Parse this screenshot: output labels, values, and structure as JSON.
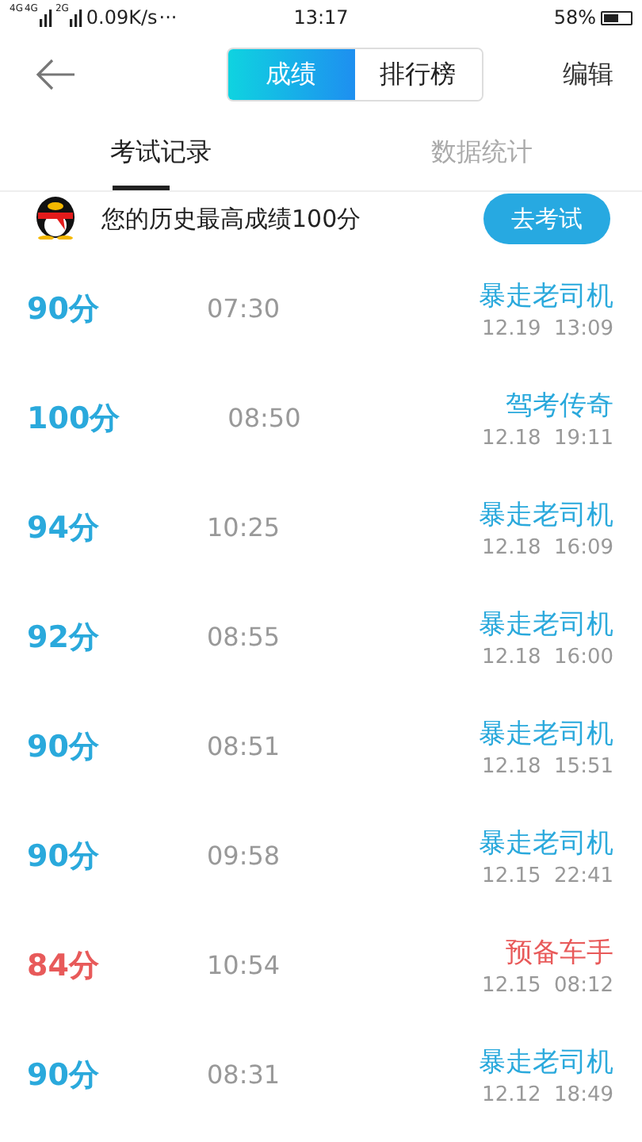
{
  "status_bar": {
    "network_labels": [
      "4G",
      "4G",
      "2G"
    ],
    "speed": "0.09K/s",
    "more": "···",
    "time": "13:17",
    "battery_text": "58%"
  },
  "header": {
    "segments": [
      {
        "label": "成绩",
        "selected": true
      },
      {
        "label": "排行榜",
        "selected": false
      }
    ],
    "action": "编辑"
  },
  "tabs": [
    {
      "label": "考试记录",
      "selected": true
    },
    {
      "label": "数据统计",
      "selected": false
    }
  ],
  "banner": {
    "text": "您的历史最高成绩100分",
    "button": "去考试"
  },
  "records": [
    {
      "score": "90分",
      "duration": "07:30",
      "title": "暴走老司机",
      "date": "12.19  13:09",
      "color": "#2aa9dc"
    },
    {
      "score": "100分",
      "duration": "08:50",
      "title": "驾考传奇",
      "date": "12.18  19:11",
      "color": "#2aa9dc"
    },
    {
      "score": "94分",
      "duration": "10:25",
      "title": "暴走老司机",
      "date": "12.18  16:09",
      "color": "#2aa9dc"
    },
    {
      "score": "92分",
      "duration": "08:55",
      "title": "暴走老司机",
      "date": "12.18  16:00",
      "color": "#2aa9dc"
    },
    {
      "score": "90分",
      "duration": "08:51",
      "title": "暴走老司机",
      "date": "12.18  15:51",
      "color": "#2aa9dc"
    },
    {
      "score": "90分",
      "duration": "09:58",
      "title": "暴走老司机",
      "date": "12.15  22:41",
      "color": "#2aa9dc"
    },
    {
      "score": "84分",
      "duration": "10:54",
      "title": "预备车手",
      "date": "12.15  08:12",
      "color": "#e85a5a"
    },
    {
      "score": "90分",
      "duration": "08:31",
      "title": "暴走老司机",
      "date": "12.12  18:49",
      "color": "#2aa9dc"
    }
  ]
}
